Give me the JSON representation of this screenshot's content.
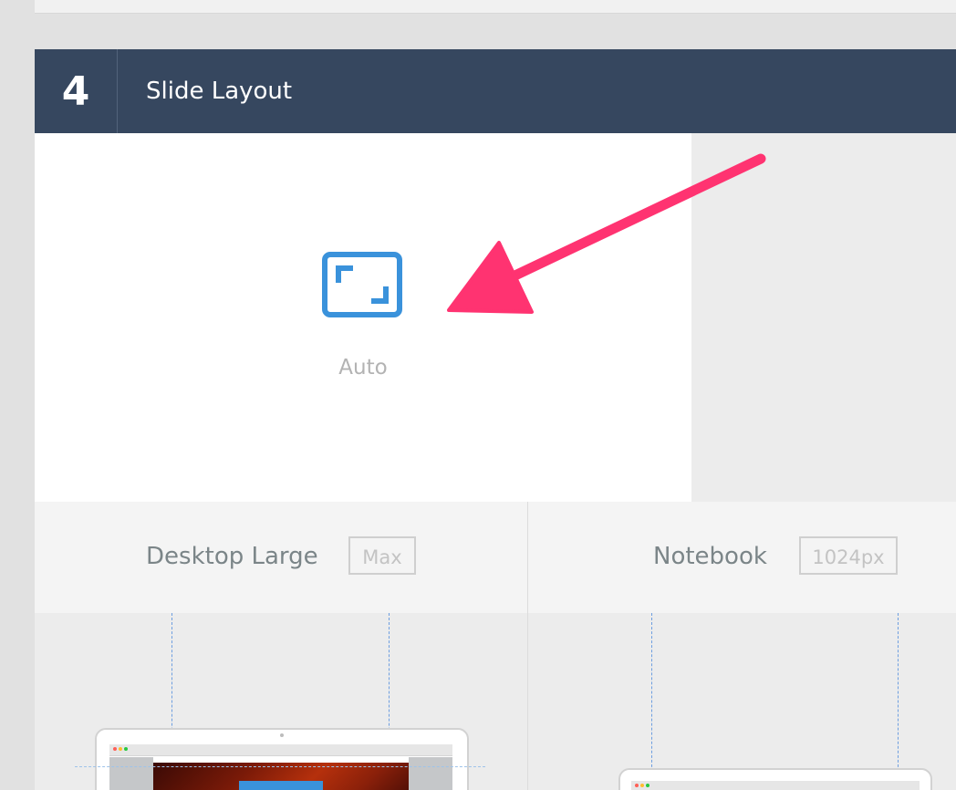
{
  "section": {
    "step_number": "4",
    "title": "Slide Layout"
  },
  "layout_options": [
    {
      "label": "Auto",
      "icon": "auto-size-icon",
      "selected": true
    }
  ],
  "devices": [
    {
      "name": "Desktop Large",
      "badge": "Max"
    },
    {
      "name": "Notebook",
      "badge": "1024px"
    }
  ],
  "colors": {
    "header_bg": "#36475f",
    "accent_blue": "#3a92db",
    "annotation_arrow": "#ff3371"
  }
}
